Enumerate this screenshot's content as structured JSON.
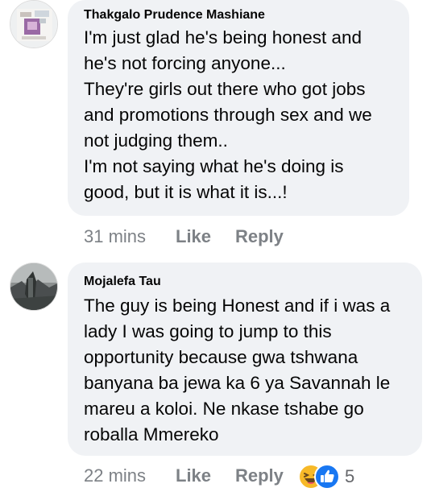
{
  "comments": [
    {
      "author": "Thakgalo Prudence Mashiane",
      "text_lines": [
        "I'm just glad he's being honest and",
        "he's not forcing anyone...",
        "They're girls out there who got jobs",
        "and promotions through sex and we",
        "not judging them..",
        "I'm not saying what he's doing is",
        "good, but it is what it is...!"
      ],
      "time": "31 mins",
      "like_label": "Like",
      "reply_label": "Reply",
      "avatar_icon": "profile-photo-icon"
    },
    {
      "author": "Mojalefa Tau",
      "text_lines": [
        "The guy is being Honest and if i was a",
        "lady I was going to jump to this",
        "opportunity because gwa tshwana",
        "banyana ba jewa ka 6 ya Savannah le",
        "mareu a koloi. Ne nkase tshabe go",
        "roballa Mmereko"
      ],
      "time": "22 mins",
      "like_label": "Like",
      "reply_label": "Reply",
      "reactions": {
        "icons": [
          "haha-icon",
          "like-icon"
        ],
        "count": "5"
      },
      "avatar_icon": "profile-photo-icon"
    }
  ],
  "colors": {
    "bubble": "#f0f2f5",
    "meta_text": "#7d8186",
    "like_blue": "#1877f2",
    "haha_yellow": "#f7b928"
  }
}
